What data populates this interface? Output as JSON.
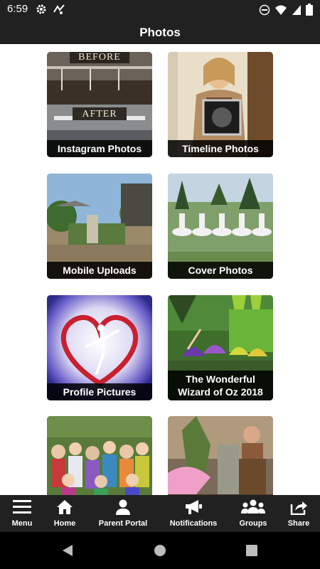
{
  "status_bar": {
    "time": "6:59",
    "left_icons": [
      "settings-icon",
      "activity-icon"
    ],
    "right_icons": [
      "do-not-disturb-icon",
      "wifi-icon",
      "signal-icon",
      "battery-icon"
    ]
  },
  "app_bar": {
    "title": "Photos"
  },
  "albums": [
    {
      "label": "Instagram Photos",
      "art_text_top": "BEFORE",
      "art_text_bottom": "AFTER"
    },
    {
      "label": "Timeline Photos"
    },
    {
      "label": "Mobile Uploads"
    },
    {
      "label": "Cover Photos"
    },
    {
      "label": "Profile Pictures"
    },
    {
      "label": "The Wonderful Wizard of Oz 2018"
    },
    {
      "label": ""
    },
    {
      "label": ""
    }
  ],
  "bottom_nav": {
    "items": [
      {
        "label": "Menu",
        "icon": "menu-icon"
      },
      {
        "label": "Home",
        "icon": "home-icon"
      },
      {
        "label": "Parent Portal",
        "icon": "person-icon"
      },
      {
        "label": "Notifications",
        "icon": "megaphone-icon"
      },
      {
        "label": "Groups",
        "icon": "groups-icon"
      },
      {
        "label": "Share",
        "icon": "share-icon"
      }
    ]
  },
  "system_nav": {
    "buttons": [
      "back-icon",
      "home-circle-icon",
      "recents-icon"
    ]
  },
  "colors": {
    "bar": "#212121",
    "caption_bg": "#000000",
    "text": "#ffffff"
  }
}
